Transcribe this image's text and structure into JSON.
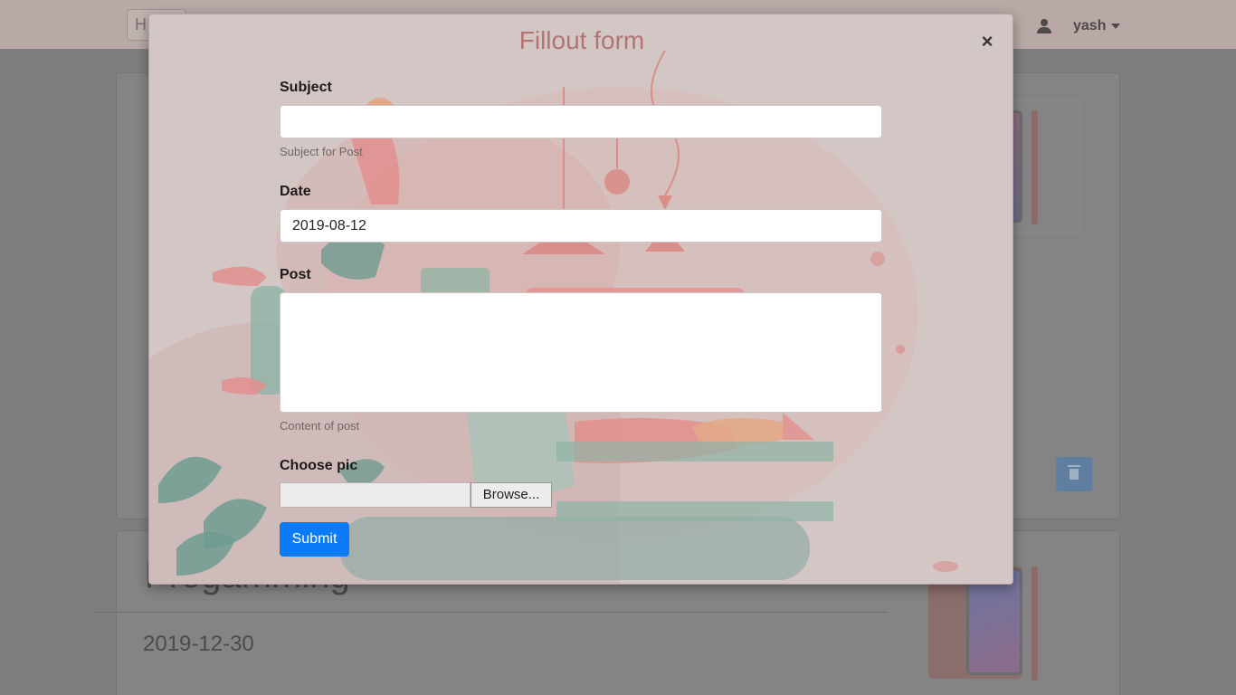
{
  "background": {
    "navbar": {
      "search_text": "H",
      "user_name": "yash"
    },
    "post": {
      "title": "Progamming",
      "date": "2019-12-30"
    }
  },
  "modal": {
    "title": "Fillout form",
    "close_label": "×",
    "fields": {
      "subject": {
        "label": "Subject",
        "value": "",
        "help": "Subject for Post"
      },
      "date": {
        "label": "Date",
        "value": "2019-08-12"
      },
      "post": {
        "label": "Post",
        "value": "",
        "help": "Content of post"
      },
      "pic": {
        "label": "Choose pic",
        "browse_label": "Browse..."
      }
    },
    "submit_label": "Submit"
  },
  "colors": {
    "modal_bg": "#d3c7c6",
    "title": "#b27472",
    "submit": "#0a7cf8"
  }
}
